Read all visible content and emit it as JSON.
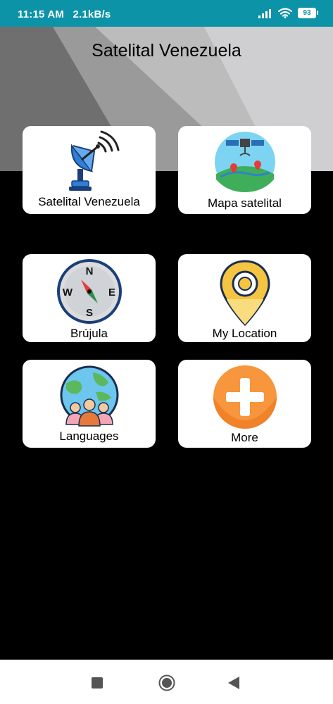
{
  "status_bar": {
    "time": "11:15 AM",
    "speed": "2.1kB/s",
    "battery": "93",
    "icons": [
      "signal-icon",
      "wifi-icon",
      "battery-icon"
    ]
  },
  "header": {
    "title": "Satelital Venezuela"
  },
  "menu": {
    "items": [
      {
        "label": "Satelital Venezuela",
        "icon": "satellite-dish-icon"
      },
      {
        "label": "Mapa satelital",
        "icon": "satellite-map-icon"
      },
      {
        "label": "Brújula",
        "icon": "compass-icon"
      },
      {
        "label": "My Location",
        "icon": "location-pin-icon"
      },
      {
        "label": "Languages",
        "icon": "globe-people-icon"
      },
      {
        "label": "More",
        "icon": "plus-icon"
      }
    ]
  },
  "nav_bar": {
    "icons": [
      "square-recents-icon",
      "circle-home-icon",
      "triangle-back-icon"
    ]
  },
  "colors": {
    "status_bar": "#0c93a8",
    "background": "#000000",
    "card": "#ffffff",
    "pin_yellow": "#f5c542",
    "plus_orange": "#f7963c"
  }
}
